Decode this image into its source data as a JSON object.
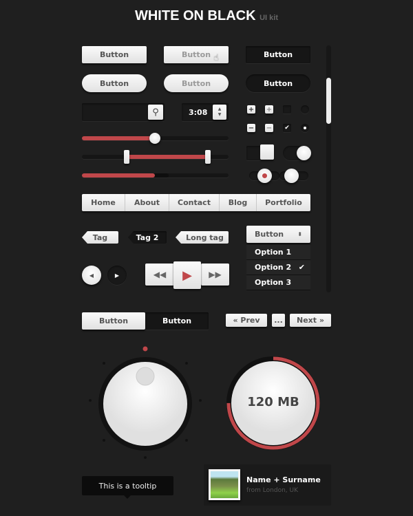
{
  "header": {
    "title": "WHITE ON BLACK",
    "subtitle": "UI kit"
  },
  "buttons": {
    "b1": "Button",
    "b2": "Button",
    "b3": "Button",
    "p1": "Button",
    "p2": "Button",
    "p3": "Button"
  },
  "time_field": {
    "value": "3:08"
  },
  "sliders": {
    "single_value_pct": 50,
    "range_low_pct": 30,
    "range_high_pct": 86,
    "progress_pct": 50
  },
  "nav": {
    "items": [
      "Home",
      "About",
      "Contact",
      "Blog",
      "Portfolio"
    ]
  },
  "tags": [
    "Tag",
    "Tag 2",
    "Long tag"
  ],
  "dropdown": {
    "selected": "Button",
    "options": [
      "Option 1",
      "Option 2",
      "Option 3"
    ],
    "checked": "Option 2"
  },
  "segmented": [
    "Button",
    "Button"
  ],
  "pagination": {
    "prev": "« Prev",
    "ellipsis": "...",
    "next": "Next »"
  },
  "storage": {
    "label": "120 MB",
    "fill_pct": 75
  },
  "tooltip": {
    "text": "This is a tooltip"
  },
  "profile": {
    "name": "Name + Surname",
    "location": "from London, UK"
  },
  "colors": {
    "accent": "#c0474a",
    "background": "#1f1f1f"
  }
}
